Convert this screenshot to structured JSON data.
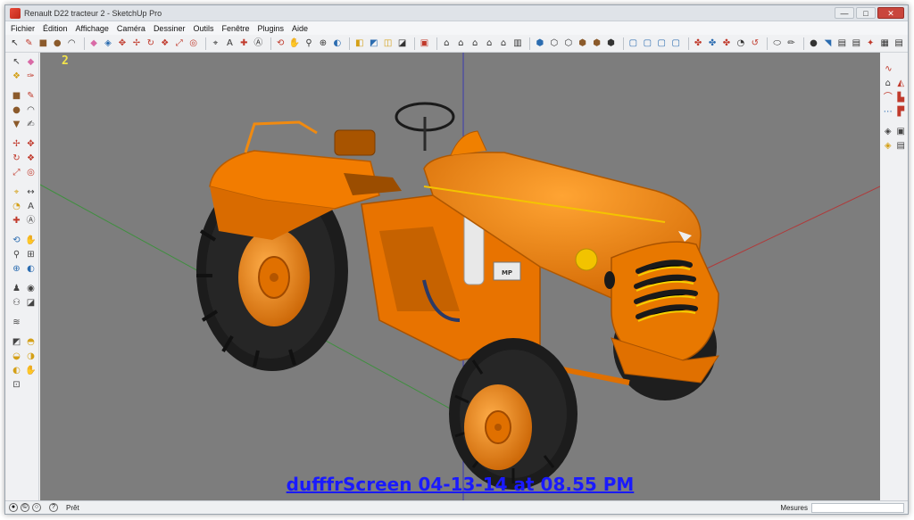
{
  "window": {
    "title": "Renault D22 tracteur 2 - SketchUp Pro",
    "controls": {
      "minimize": "—",
      "maximize": "□",
      "close": "✕"
    }
  },
  "menu": {
    "items": [
      "Fichier",
      "Édition",
      "Affichage",
      "Caméra",
      "Dessiner",
      "Outils",
      "Fenêtre",
      "Plugins",
      "Aide"
    ]
  },
  "viewport": {
    "scene_counter": "2",
    "caption": "dufffrScreen 04-13-14 at 08.55 PM",
    "background_color": "#7d7d7d",
    "model_color": "#f07d00"
  },
  "statusbar": {
    "status_text": "Prêt",
    "measure_label": "Mesures",
    "measure_value": ""
  },
  "icons": {
    "toolbar": [
      "pointer-icon",
      "pencil-icon",
      "rectangle-icon",
      "circle-icon",
      "arc-icon",
      "eraser-icon",
      "paint-bucket-icon",
      "push-pull-icon",
      "move-icon",
      "rotate-icon",
      "follow-me-icon",
      "scale-icon",
      "offset-icon",
      "tape-measure-icon",
      "text-icon",
      "axes-icon",
      "3d-text-icon",
      "orbit-icon",
      "pan-icon",
      "zoom-icon",
      "zoom-extents-icon",
      "previous-view-icon",
      "get-models-icon",
      "share-model-icon",
      "component-icon",
      "section-plane-icon",
      "iso-view-icon",
      "top-view-icon",
      "front-view-icon",
      "right-view-icon",
      "back-view-icon",
      "left-view-icon",
      "xray-icon",
      "wireframe-icon",
      "hidden-line-icon",
      "shaded-icon",
      "textured-icon",
      "monochrome-icon",
      "sandbox-icon",
      "layer-icon",
      "shadow-icon",
      "fog-icon",
      "style-icon",
      "match-photo-icon",
      "geo-location-icon",
      "photo-texture-icon",
      "solid-tools-icon",
      "dynamic-component-icon",
      "warehouse-icon",
      "export-icon"
    ]
  }
}
